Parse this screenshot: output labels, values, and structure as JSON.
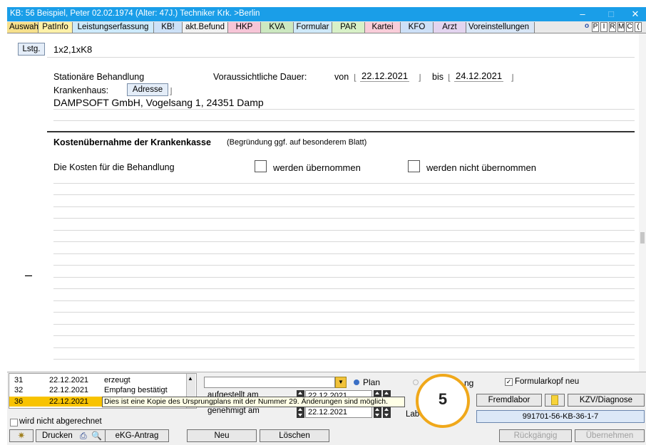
{
  "window": {
    "title": "KB: 56  Beispiel, Peter  02.02.1974 (Alter: 47J.)  Techniker Krk. >Berlin",
    "minimize": "–",
    "maximize": "□",
    "close": "✕"
  },
  "tabs": [
    {
      "label": "Auswahl",
      "color": "#f6e08c"
    },
    {
      "label": "PatInfo",
      "color": "#fff1a8"
    },
    {
      "label": "Leistungserfassung",
      "color": "#cdeafb"
    },
    {
      "label": "KB!",
      "color": "#cde1f7"
    },
    {
      "label": "akt.Befund",
      "color": "#f2f2f2"
    },
    {
      "label": "HKP",
      "color": "#f7c5d7"
    },
    {
      "label": "KVA",
      "color": "#cce8c0"
    },
    {
      "label": "Formular",
      "color": "#cfe9f9"
    },
    {
      "label": "PAR",
      "color": "#d8f1c7"
    },
    {
      "label": "Kartei",
      "color": "#f9cdd9"
    },
    {
      "label": "KFO",
      "color": "#cde0f7"
    },
    {
      "label": "Arzt",
      "color": "#e3d4ef"
    },
    {
      "label": "Voreinstellungen",
      "color": "#d8e6f6"
    }
  ],
  "tab_tail": [
    "P",
    "I",
    "R",
    "M",
    "C",
    "("
  ],
  "tab_tail_icon": "o",
  "form": {
    "lstg_button": "Lstg.",
    "lstg_value": "1x2,1xK8",
    "stationaer_label": "Stationäre Behandlung",
    "dauer_label": "Voraussichtliche Dauer:",
    "von_label": "von",
    "von_date": "22.12.2021",
    "bis_label": "bis",
    "bis_date": "24.12.2021",
    "krankenhaus_label": "Krankenhaus:",
    "adresse_button": "Adresse",
    "address": "DAMPSOFT GmbH, Vogelsang 1, 24351 Damp",
    "kosten_heading": "Kostenübernahme der Krankenkasse",
    "kosten_subheading": "(Begründung ggf. auf besonderem Blatt)",
    "kosten_text": "Die Kosten für die Behandlung",
    "option_yes": "werden übernommen",
    "option_no": "werden nicht übernommen",
    "dash": "–"
  },
  "history": [
    {
      "nr": "31",
      "date": "22.12.2021",
      "status": "erzeugt"
    },
    {
      "nr": "32",
      "date": "22.12.2021",
      "status": "Empfang bestätigt"
    },
    {
      "nr": "36",
      "date": "22.12.2021",
      "status": ""
    }
  ],
  "tooltip": "Dies ist eine Kopie des Ursprungplans mit der Nummer 29. Änderungen sind möglich.",
  "radio_plan": "Plan",
  "radio_other_partial": "ng",
  "formularkopf": "Formularkopf neu",
  "aufgestellt_label": "aufgestellt am",
  "aufgestellt_value": "22.12.2021",
  "genehmigt_label": "genehmigt am",
  "genehmigt_value": "22.12.2021",
  "labor_label": "Labor",
  "callout_number": "5",
  "fremdlabor_button": "Fremdlabor",
  "kzv_button": "KZV/Diagnose",
  "code_button": "991701-56-KB-36-1-7",
  "wird_nicht": "wird nicht abgerechnet",
  "bottom_buttons": {
    "drucken": "Drucken",
    "ekg": "eKG-Antrag",
    "neu": "Neu",
    "loeschen": "Löschen",
    "rueckgaengig": "Rückgängig",
    "uebernehmen": "Übernehmen"
  },
  "accent_color": "#1a9ee8",
  "callout_color": "#f0a81a"
}
